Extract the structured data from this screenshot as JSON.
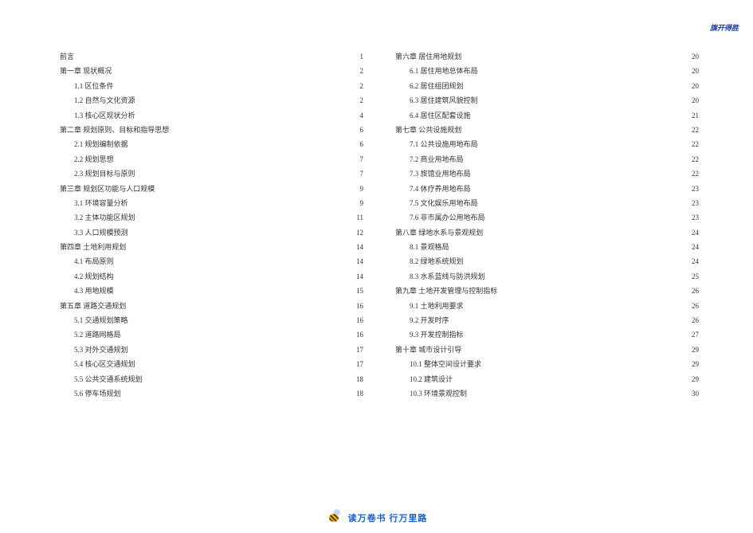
{
  "header": {
    "right_label": "旗开得胜"
  },
  "footer": {
    "motto": "读万卷书 行万里路",
    "icon_name": "bee-icon"
  },
  "toc": {
    "left": [
      {
        "label": "前言",
        "page": "1",
        "sub": false
      },
      {
        "label": "第一章  现状概况",
        "page": "2",
        "sub": false
      },
      {
        "label": "1.1 区位条件",
        "page": "2",
        "sub": true
      },
      {
        "label": "1.2 自然与文化资源",
        "page": "2",
        "sub": true
      },
      {
        "label": "1.3 核心区现状分析",
        "page": "4",
        "sub": true
      },
      {
        "label": "第二章  规划原则、目标和指导思想",
        "page": "6",
        "sub": false
      },
      {
        "label": "2.1 规划编制依据",
        "page": "6",
        "sub": true
      },
      {
        "label": "2.2 规划思想",
        "page": "7",
        "sub": true
      },
      {
        "label": "2.3 规划目标与原则",
        "page": "7",
        "sub": true
      },
      {
        "label": "第三章  规划区功能与人口规模",
        "page": "9",
        "sub": false
      },
      {
        "label": "3.1 环境容量分析",
        "page": "9",
        "sub": true
      },
      {
        "label": "3.2 主体功能区规划",
        "page": "11",
        "sub": true
      },
      {
        "label": "3.3 人口规模预测",
        "page": "12",
        "sub": true
      },
      {
        "label": "第四章  土地利用规划",
        "page": "14",
        "sub": false
      },
      {
        "label": "4.1 布局原则",
        "page": "14",
        "sub": true
      },
      {
        "label": "4.2 规划结构",
        "page": "14",
        "sub": true
      },
      {
        "label": "4.3 用地规模",
        "page": "15",
        "sub": true
      },
      {
        "label": "第五章  道路交通规划",
        "page": "16",
        "sub": false
      },
      {
        "label": "5.1 交通规划策略",
        "page": "16",
        "sub": true
      },
      {
        "label": "5.2 道路网格局",
        "page": "16",
        "sub": true
      },
      {
        "label": "5.3 对外交通规划",
        "page": "17",
        "sub": true
      },
      {
        "label": "5.4 核心区交通规划",
        "page": "17",
        "sub": true
      },
      {
        "label": "5.5 公共交通系统规划",
        "page": "18",
        "sub": true
      },
      {
        "label": "5.6 停车场规划",
        "page": "18",
        "sub": true
      }
    ],
    "right": [
      {
        "label": "第六章  居住用地规划",
        "page": "20",
        "sub": false
      },
      {
        "label": "6.1 居住用地总体布局",
        "page": "20",
        "sub": true
      },
      {
        "label": "6.2 居住组团规划",
        "page": "20",
        "sub": true
      },
      {
        "label": "6.3 居住建筑风貌控制",
        "page": "20",
        "sub": true
      },
      {
        "label": "6.4 居住区配套设施",
        "page": "21",
        "sub": true
      },
      {
        "label": "第七章  公共设施规划",
        "page": "22",
        "sub": false
      },
      {
        "label": "7.1 公共设施用地布局",
        "page": "22",
        "sub": true
      },
      {
        "label": "7.2 商业用地布局",
        "page": "22",
        "sub": true
      },
      {
        "label": "7.3 旅馆业用地布局",
        "page": "22",
        "sub": true
      },
      {
        "label": "7.4 休疗养用地布局",
        "page": "23",
        "sub": true
      },
      {
        "label": "7.5 文化娱乐用地布局",
        "page": "23",
        "sub": true
      },
      {
        "label": "7.6 非市属办公用地布局",
        "page": "23",
        "sub": true
      },
      {
        "label": "第八章  绿地水系与景观规划",
        "page": "24",
        "sub": false
      },
      {
        "label": "8.1 景观格局",
        "page": "24",
        "sub": true
      },
      {
        "label": "8.2 绿地系统规划",
        "page": "24",
        "sub": true
      },
      {
        "label": "8.3 水系蓝线与防洪规划",
        "page": "25",
        "sub": true
      },
      {
        "label": "第九章  土地开发管理与控制指标",
        "page": "26",
        "sub": false
      },
      {
        "label": "9.1 土地利用要求",
        "page": "26",
        "sub": true
      },
      {
        "label": "9.2 开发时序",
        "page": "26",
        "sub": true
      },
      {
        "label": "9.3 开发控制指标",
        "page": "27",
        "sub": true
      },
      {
        "label": "第十章  城市设计引导",
        "page": "29",
        "sub": false
      },
      {
        "label": "10.1 整体空间设计要求",
        "page": "29",
        "sub": true
      },
      {
        "label": "10.2 建筑设计",
        "page": "29",
        "sub": true
      },
      {
        "label": "10.3 环境景观控制",
        "page": "30",
        "sub": true
      }
    ]
  }
}
